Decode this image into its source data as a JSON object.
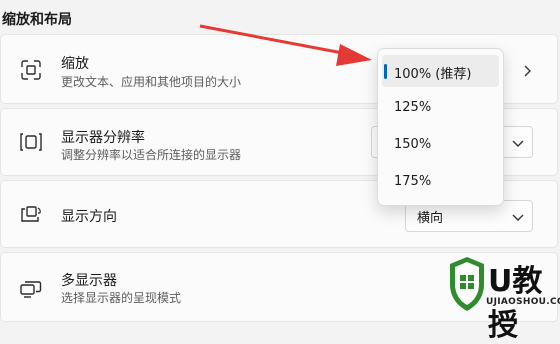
{
  "section": {
    "title": "缩放和布局"
  },
  "scale": {
    "title": "缩放",
    "subtitle": "更改文本、应用和其他项目的大小"
  },
  "resolution": {
    "title": "显示器分辨率",
    "subtitle": "调整分辨率以适合所连接的显示器"
  },
  "orientation": {
    "title": "显示方向",
    "value": "横向"
  },
  "multi": {
    "title": "多显示器",
    "subtitle": "选择显示器的呈现模式"
  },
  "scale_options": [
    "100% (推荐)",
    "125%",
    "150%",
    "175%"
  ],
  "selected_index": 0,
  "watermark": {
    "brand": "U教授",
    "url": "UJIAOSHOU.COM"
  },
  "colors": {
    "accent": "#0067c0",
    "arrow": "#e53935",
    "watermark_green": "#2e8b2e"
  },
  "icons": {
    "scale": "scale-icon",
    "resolution": "resolution-icon",
    "orientation": "orientation-icon",
    "multi": "multi-display-icon",
    "chevron_right": "chevron-right-icon",
    "chevron_down": "chevron-down-icon"
  }
}
